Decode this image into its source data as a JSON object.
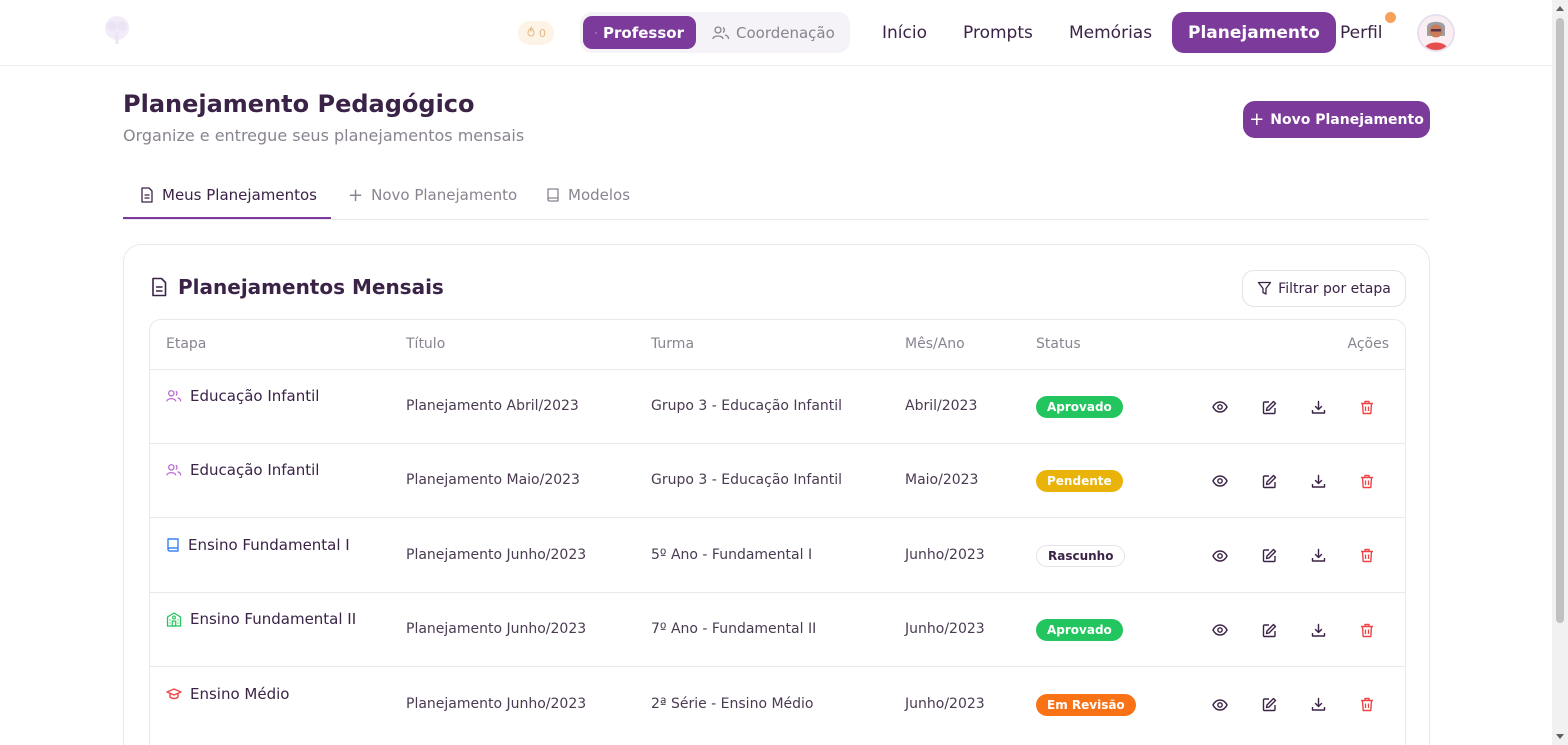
{
  "nav": {
    "streak": "0",
    "roles": [
      {
        "label": "Professor",
        "active": true
      },
      {
        "label": "Coordenação",
        "active": false
      }
    ],
    "items": [
      {
        "label": "Início"
      },
      {
        "label": "Prompts"
      },
      {
        "label": "Memórias"
      },
      {
        "label": "Planejamento"
      },
      {
        "label": "Perfil"
      }
    ]
  },
  "header": {
    "title": "Planejamento Pedagógico",
    "subtitle": "Organize e entregue seus planejamentos mensais",
    "new_button": "Novo Planejamento"
  },
  "tabs": [
    {
      "label": "Meus Planejamentos",
      "icon": "document-icon"
    },
    {
      "label": "Novo Planejamento",
      "icon": "plus-icon"
    },
    {
      "label": "Modelos",
      "icon": "book-icon"
    }
  ],
  "card": {
    "title": "Planejamentos Mensais",
    "filter": "Filtrar por etapa"
  },
  "table": {
    "columns": [
      "Etapa",
      "Título",
      "Turma",
      "Mês/Ano",
      "Status",
      "Ações"
    ],
    "rows": [
      {
        "etapa": "Educação Infantil",
        "icon": "users-icon",
        "titulo": "Planejamento Abril/2023",
        "turma": "Grupo 3 - Educação Infantil",
        "mes": "Abril/2023",
        "status": "Aprovado"
      },
      {
        "etapa": "Educação Infantil",
        "icon": "users-icon",
        "titulo": "Planejamento Maio/2023",
        "turma": "Grupo 3 - Educação Infantil",
        "mes": "Maio/2023",
        "status": "Pendente"
      },
      {
        "etapa": "Ensino Fundamental I",
        "icon": "book-icon",
        "titulo": "Planejamento Junho/2023",
        "turma": "5º Ano - Fundamental I",
        "mes": "Junho/2023",
        "status": "Rascunho"
      },
      {
        "etapa": "Ensino Fundamental II",
        "icon": "school-icon",
        "titulo": "Planejamento Junho/2023",
        "turma": "7º Ano - Fundamental II",
        "mes": "Junho/2023",
        "status": "Aprovado"
      },
      {
        "etapa": "Ensino Médio",
        "icon": "graduation-cap-icon",
        "titulo": "Planejamento Junho/2023",
        "turma": "2ª Série - Ensino Médio",
        "mes": "Junho/2023",
        "status": "Em Revisão"
      }
    ]
  },
  "colors": {
    "primary": "#7c3a9b",
    "approved": "#22c55e",
    "pending": "#eab308",
    "review": "#f97316",
    "delete": "#ef4444"
  }
}
